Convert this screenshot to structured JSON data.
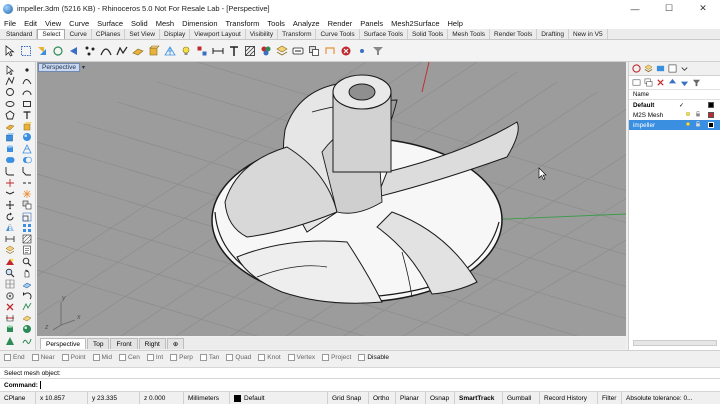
{
  "title_bar": {
    "title": "impeller.3dm (5216 KB) - Rhinoceros 5.0 Not For Resale Lab - [Perspective]",
    "minimize": "—",
    "maximize": "☐",
    "close": "✕"
  },
  "menu": [
    "File",
    "Edit",
    "View",
    "Curve",
    "Surface",
    "Solid",
    "Mesh",
    "Dimension",
    "Transform",
    "Tools",
    "Analyze",
    "Render",
    "Panels",
    "Mesh2Surface",
    "Help"
  ],
  "tool_tabs": {
    "items": [
      "Standard",
      "Select",
      "Curve",
      "CPlanes",
      "Set View",
      "Display",
      "Viewport Layout",
      "Visibility",
      "Transform",
      "Curve Tools",
      "Surface Tools",
      "Solid Tools",
      "Mesh Tools",
      "Render Tools",
      "Drafting",
      "New in V5"
    ],
    "active": "Select"
  },
  "viewport": {
    "label": "Perspective",
    "label_arrow": "▾",
    "axis_y": "y",
    "axis_x": "x",
    "axis_z": "z"
  },
  "viewport_tabs": [
    "Perspective",
    "Top",
    "Front",
    "Right"
  ],
  "viewport_tab_add": "⊕",
  "osnaps": [
    "End",
    "Near",
    "Point",
    "Mid",
    "Cen",
    "Int",
    "Perp",
    "Tan",
    "Quad",
    "Knot",
    "Vertex",
    "Project",
    "Disable"
  ],
  "command": {
    "history": "Select mesh object:",
    "prompt": "Command:"
  },
  "status": {
    "cplane": "CPlane",
    "x": "x 10.857",
    "y": "y 23.335",
    "z": "z 0.000",
    "units": "Millimeters",
    "layer": "Default",
    "grid_snap": "Grid Snap",
    "ortho": "Ortho",
    "planar": "Planar",
    "osnap": "Osnap",
    "smarttrack": "SmartTrack",
    "gumball": "Gumball",
    "record_history": "Record History",
    "filter": "Filter",
    "tolerance": "Absolute tolerance: 0..."
  },
  "layers_panel": {
    "header_name": "Name",
    "rows": [
      {
        "name": "Default",
        "mark": "✓",
        "color": "#000000"
      },
      {
        "name": "M2S Mesh",
        "mark": "",
        "color": "#c0282d"
      },
      {
        "name": "impeller",
        "mark": "",
        "color": "#000000"
      }
    ]
  }
}
